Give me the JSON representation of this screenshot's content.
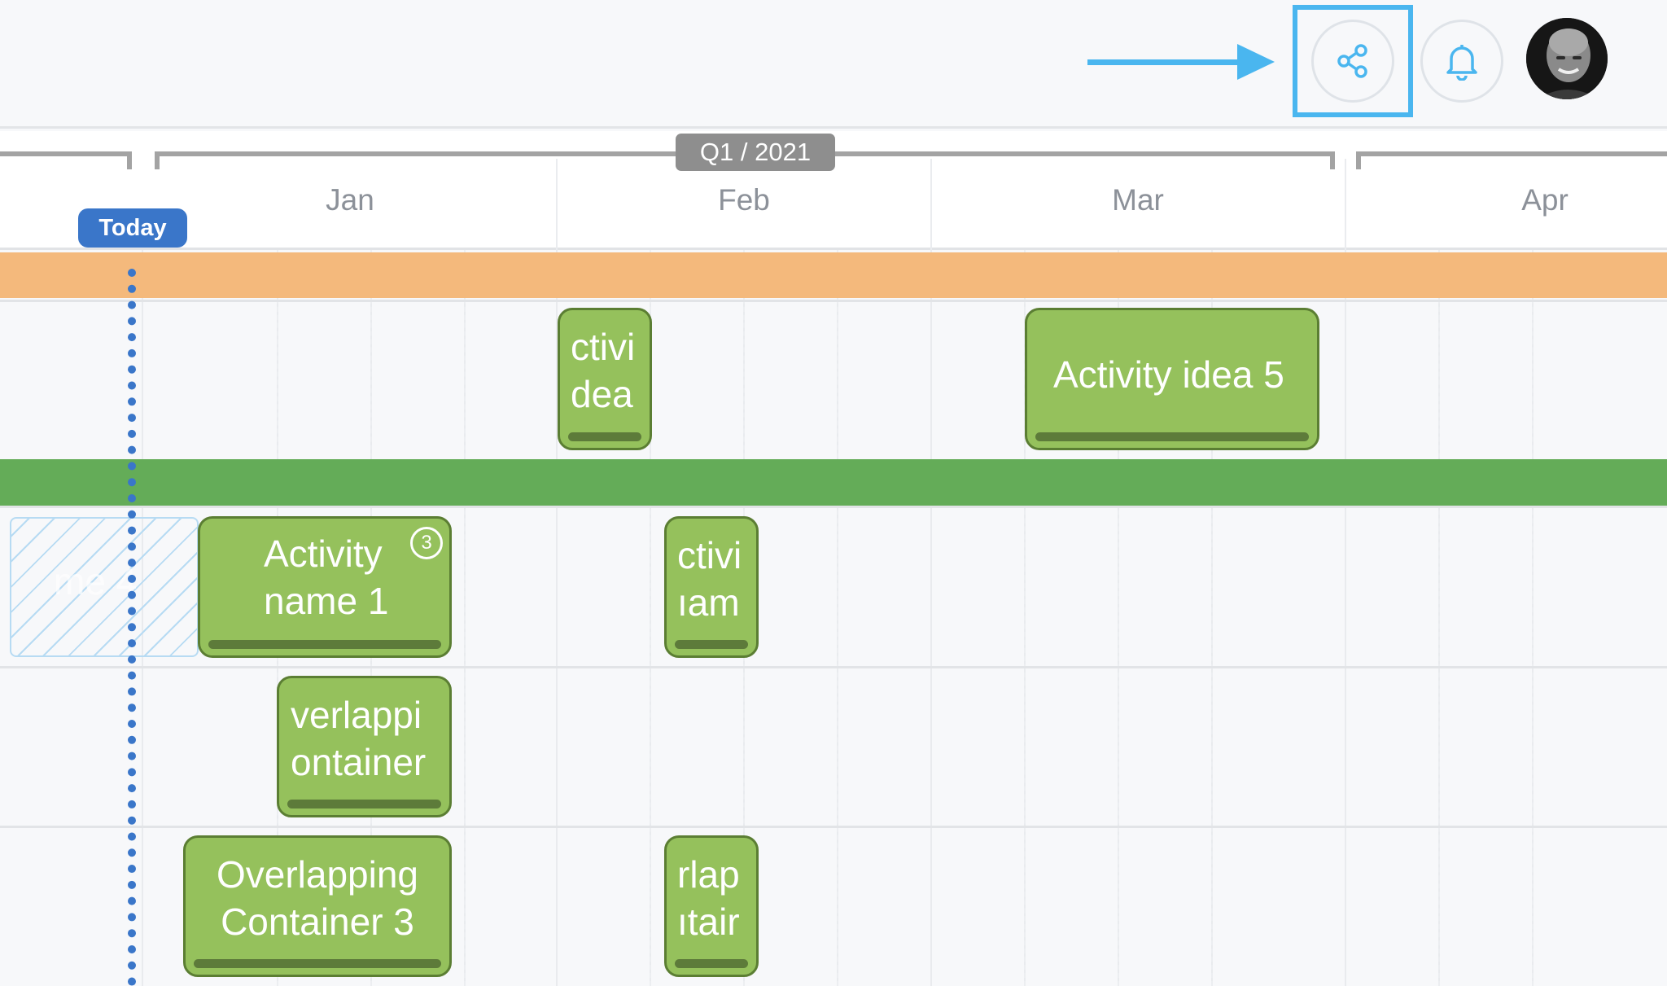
{
  "header": {
    "share_icon": "share-icon",
    "bell_icon": "bell-icon",
    "avatar": "user-avatar",
    "accent_color": "#4ab6ef"
  },
  "timeline": {
    "quarter_label": "Q1 / 2021",
    "months": [
      "Jan",
      "Feb",
      "Mar",
      "Apr"
    ],
    "today_label": "Today",
    "today_color": "#3a76c9",
    "lane_colors": {
      "orange": "#f4b97c",
      "green": "#64ac58"
    }
  },
  "activities": {
    "idea_partial_line1": "ctivi",
    "idea_partial_line2": "dea",
    "idea5": "Activity idea 5",
    "placeholder_text": "me 4",
    "name1_line1": "Activity",
    "name1_line2": "name 1",
    "name1_badge": "3",
    "name_partial_line1": "ctivi",
    "name_partial_line2": "ıam",
    "overlap2_line1": "verlappi",
    "overlap2_line2": "ontainer",
    "overlap3_line1": "Overlapping",
    "overlap3_line2": "Container 3",
    "overlap_partial_line1": "rlap",
    "overlap_partial_line2": "ıtair",
    "card_color": "#95c15c"
  }
}
